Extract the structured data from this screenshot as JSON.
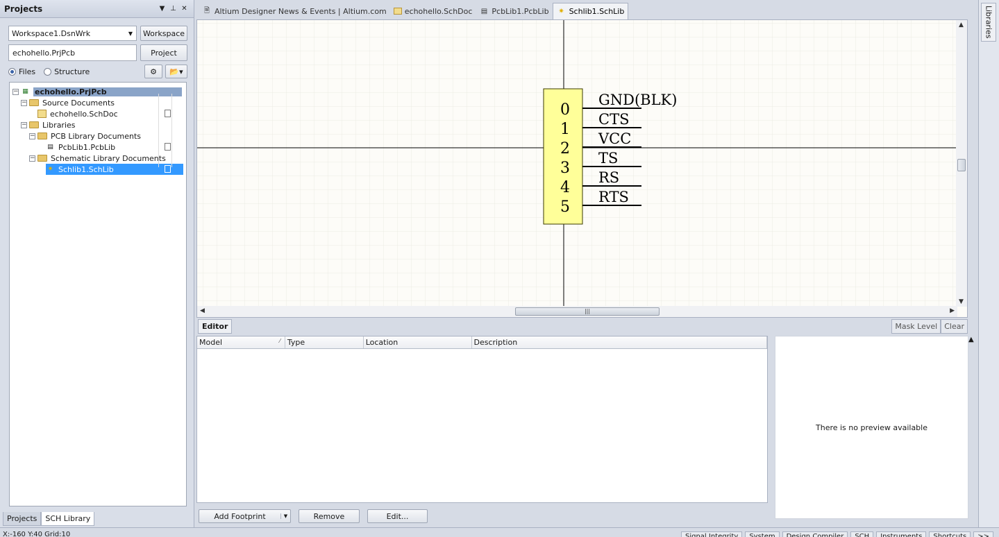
{
  "projects_panel": {
    "title": "Projects",
    "workspace": {
      "value": "Workspace1.DsnWrk",
      "button": "Workspace"
    },
    "project": {
      "value": "echohello.PrjPcb",
      "button": "Project"
    },
    "view_modes": {
      "files": "Files",
      "structure": "Structure",
      "selected": "Files"
    },
    "tree": {
      "root": "echohello.PrjPcb",
      "source_documents": "Source Documents",
      "schdoc": "echohello.SchDoc",
      "libraries": "Libraries",
      "pcb_library_documents": "PCB Library Documents",
      "pcblib": "PcbLib1.PcbLib",
      "schematic_library_documents": "Schematic Library Documents",
      "schlib": "Schlib1.SchLib"
    },
    "bottom_tabs": [
      "Projects",
      "SCH Library"
    ]
  },
  "doc_tabs": [
    {
      "label": "Altium Designer News & Events | Altium.com",
      "icon": "globe-icon"
    },
    {
      "label": "echohello.SchDoc",
      "icon": "schdoc-icon"
    },
    {
      "label": "PcbLib1.PcbLib",
      "icon": "pcblib-icon"
    },
    {
      "label": "Schlib1.SchLib",
      "icon": "schlib-icon",
      "active": true
    }
  ],
  "component": {
    "pins": [
      {
        "number": "0",
        "name": "GND(BLK)"
      },
      {
        "number": "1",
        "name": "CTS"
      },
      {
        "number": "2",
        "name": "VCC"
      },
      {
        "number": "3",
        "name": "TS"
      },
      {
        "number": "4",
        "name": "RS"
      },
      {
        "number": "5",
        "name": "RTS"
      }
    ]
  },
  "editor": {
    "tab": "Editor",
    "mask_level": "Mask Level",
    "clear": "Clear",
    "columns": {
      "model": "Model",
      "type": "Type",
      "location": "Location",
      "description": "Description"
    },
    "preview_text": "There is no preview available",
    "buttons": {
      "add_footprint": "Add Footprint",
      "remove": "Remove",
      "edit": "Edit..."
    }
  },
  "right_rail": {
    "libraries": "Libraries"
  },
  "statusbar": {
    "coords": "X:-160 Y:40    Grid:10",
    "tabs": [
      "Signal Integrity",
      "System",
      "Design Compiler",
      "SCH",
      "Instruments",
      "Shortcuts"
    ]
  },
  "colors": {
    "component_fill": "#ffff99",
    "selection": "#3399ff",
    "canvas_bg": "#fdfcf8",
    "grid": "#ecebe3"
  }
}
